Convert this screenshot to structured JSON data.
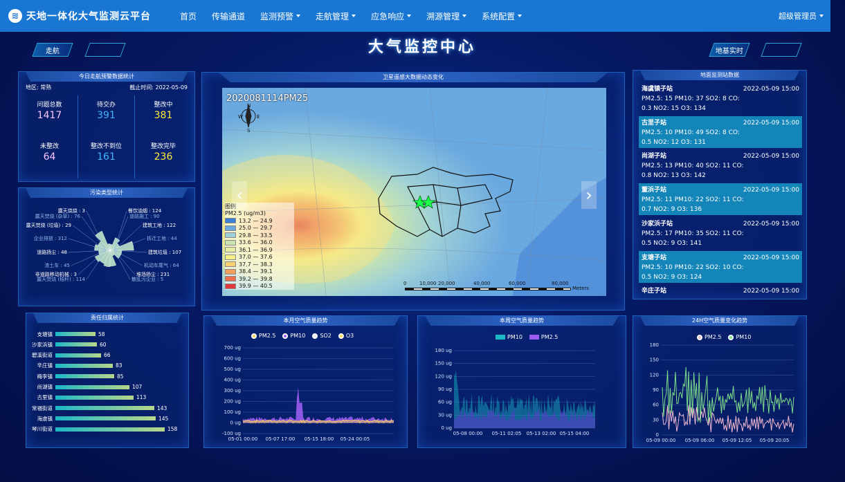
{
  "app": {
    "title": "天地一体化大气监测云平台",
    "logo_glyph": "≋"
  },
  "nav": {
    "items": [
      {
        "label": "首页",
        "dropdown": false
      },
      {
        "label": "传输通道",
        "dropdown": false
      },
      {
        "label": "监测预警",
        "dropdown": true
      },
      {
        "label": "走航管理",
        "dropdown": true
      },
      {
        "label": "应急响应",
        "dropdown": true
      },
      {
        "label": "溯源管理",
        "dropdown": true
      },
      {
        "label": "系统配置",
        "dropdown": true
      }
    ],
    "user": "超级管理员"
  },
  "page": {
    "title": "大气监控中心",
    "btn_left": "走航",
    "btn_right": "地基实时"
  },
  "alarm": {
    "title": "今日走航预警数据统计",
    "region": "地区: 常熟",
    "cutoff": "截止时间: 2022-05-09",
    "stats": [
      {
        "label": "问题总数",
        "value": "1417",
        "color": "#f6c6ff"
      },
      {
        "label": "待交办",
        "value": "391",
        "color": "#3fb6ff"
      },
      {
        "label": "整改中",
        "value": "381",
        "color": "#ffeb3b"
      },
      {
        "label": "未整改",
        "value": "64",
        "color": "#f6c6ff"
      },
      {
        "label": "整改不到位",
        "value": "161",
        "color": "#3fb6ff"
      },
      {
        "label": "整改完毕",
        "value": "236",
        "color": "#ffeb3b"
      }
    ]
  },
  "pollution": {
    "title": "污染类型统计",
    "left": [
      "露天烧烧 : 3",
      "露天焚烧 (杂草) : 76",
      "露天焚烧 (垃圾) : 29",
      "企业排放 : 312",
      "道路扬尘 : 48",
      "渣土车 : 45",
      "非道路移动机械 : 3",
      "露天焚烧 (秸秆) : 114"
    ],
    "right": [
      "餐饮油烟 : 124",
      "道路施工 : 90",
      "建筑工地 : 122",
      "拆迁工地 : 44",
      "建筑垃圾 : 107",
      "机动车尾气 : 64",
      "堆场扬尘 : 231",
      "散乱污企业 : 5"
    ]
  },
  "responsibility": {
    "title": "责任归属统计",
    "items": [
      {
        "name": "支塘镇",
        "value": "58",
        "v": 58
      },
      {
        "name": "沙家浜镇",
        "value": "60",
        "v": 60
      },
      {
        "name": "碧溪街道",
        "value": "66",
        "v": 66
      },
      {
        "name": "辛庄镇",
        "value": "83",
        "v": 83
      },
      {
        "name": "梅李镇",
        "value": "85",
        "v": 85
      },
      {
        "name": "尚湖镇",
        "value": "107",
        "v": 107
      },
      {
        "name": "古里镇",
        "value": "113",
        "v": 113
      },
      {
        "name": "常福街道",
        "value": "143",
        "v": 143
      },
      {
        "name": "海虞镇",
        "value": "145",
        "v": 145
      },
      {
        "name": "琴川街道",
        "value": "158",
        "v": 158
      }
    ]
  },
  "satellite": {
    "title": "卫星遥感大数据动态变化",
    "stamp": "2020081114PM25",
    "legend_title": "图例",
    "legend_unit": "PM2.5 (ug/m3)",
    "legend": [
      {
        "range": "13.2 — 24.9",
        "color": "#3c7fd6"
      },
      {
        "range": "25.0 — 29.7",
        "color": "#6aa8e0"
      },
      {
        "range": "29.8 — 33.5",
        "color": "#9dd0d8"
      },
      {
        "range": "33.6 — 36.0",
        "color": "#c8e3b0"
      },
      {
        "range": "36.1 — 36.9",
        "color": "#e5eea0"
      },
      {
        "range": "37.0 — 37.6",
        "color": "#f7ef86"
      },
      {
        "range": "37.7 — 38.3",
        "color": "#f8cf70"
      },
      {
        "range": "38.4 — 39.1",
        "color": "#f4a05c"
      },
      {
        "range": "39.2 — 39.8",
        "color": "#ee704f"
      },
      {
        "range": "39.9 — 40.5",
        "color": "#e0373d"
      }
    ],
    "scale": [
      "0",
      "10,000",
      "20,000",
      "40,000",
      "60,000",
      "80,000"
    ],
    "scale_unit": "Meters",
    "compass": {
      "n": "N",
      "s": "S",
      "e": "E",
      "w": "W"
    }
  },
  "stations": {
    "title": "地面监测站数据",
    "items": [
      {
        "name": "海虞镇子站",
        "time": "2022-05-09 15:00",
        "line1": "PM2.5: 15 PM10: 37 SO2: 8 CO:",
        "line2": "0.3 NO2: 15 O3: 134"
      },
      {
        "name": "古里子站",
        "time": "2022-05-09 15:00",
        "line1": "PM2.5: 10 PM10: 49 SO2: 8 CO:",
        "line2": "0.5 NO2: 12 O3: 131"
      },
      {
        "name": "尚湖子站",
        "time": "2022-05-09 15:00",
        "line1": "PM2.5: 13 PM10: 40 SO2: 11 CO:",
        "line2": "0.8 NO2: 13 O3: 142"
      },
      {
        "name": "董浜子站",
        "time": "2022-05-09 15:00",
        "line1": "PM2.5: 11 PM10: 22 SO2: 11 CO:",
        "line2": "0.7 NO2: 9 O3: 136"
      },
      {
        "name": "沙家浜子站",
        "time": "2022-05-09 15:00",
        "line1": "PM2.5: 17 PM10: 35 SO2: 11 CO:",
        "line2": "0.5 NO2: 9 O3: 141"
      },
      {
        "name": "支塘子站",
        "time": "2022-05-09 15:00",
        "line1": "PM2.5: 10 PM10: 22 SO2: 10 CO:",
        "line2": "0.5 NO2: 9 O3: 124"
      },
      {
        "name": "辛庄子站",
        "time": "2022-05-09 15:00",
        "line1": "",
        "line2": ""
      }
    ]
  },
  "month": {
    "title": "本月空气质量趋势",
    "legend": [
      "PM2.5",
      "PM10",
      "SO2",
      "O3"
    ],
    "yticks": [
      "700 ug",
      "600 ug",
      "500 ug",
      "400 ug",
      "300 ug",
      "200 ug",
      "100 ug",
      "0 ug",
      "-100 ug"
    ],
    "xticks": [
      "05-01 00:00",
      "05-07 17:00",
      "05-15 18:00",
      "05-24 00:05"
    ]
  },
  "week": {
    "title": "本周空气质量趋势",
    "legend": [
      "PM10",
      "PM2.5"
    ],
    "yticks": [
      "180 ug",
      "150 ug",
      "120 ug",
      "90 ug",
      "60 ug",
      "30 ug",
      "0 ug"
    ],
    "xticks": [
      "05-08 00:00",
      "05-11 02:05",
      "05-13 02:00",
      "05-15 04:00"
    ]
  },
  "day": {
    "title": "24H空气质量变化趋势",
    "legend": [
      "PM2.5",
      "PM10"
    ],
    "yticks": [
      "180",
      "150",
      "120",
      "90",
      "60",
      "30",
      "0"
    ],
    "xticks": [
      "05-09 00:00",
      "05-09 06:00",
      "05-09 12:05",
      "05-09 20:05"
    ]
  },
  "colors": {
    "nav": "#1976d2",
    "panel_border": "#1e5fb8",
    "bar": "#b8d68a",
    "pm10_line": "#7ee08a",
    "pm25_line": "#f2b8d0",
    "purple": "#9a5cf0",
    "teal": "#1bb8c8"
  }
}
